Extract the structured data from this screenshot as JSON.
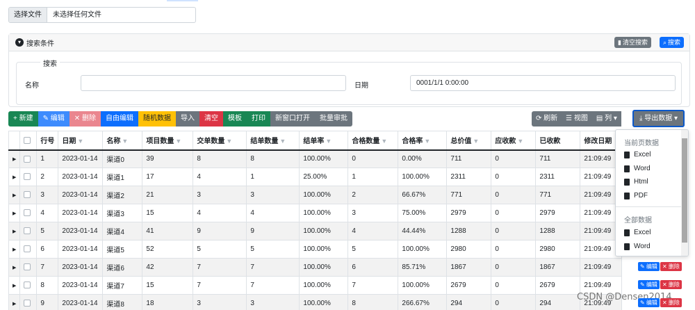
{
  "file_input": {
    "button": "选择文件",
    "text": "未选择任何文件"
  },
  "search_panel": {
    "title": "搜索条件",
    "clear_label": "清空搜索",
    "search_label": "搜索",
    "legend": "搜索",
    "name_label": "名称",
    "name_value": "",
    "date_label": "日期",
    "date_value": "0001/1/1 0:00:00"
  },
  "toolbar": {
    "new": "+ 新建",
    "edit": "✎ 编辑",
    "delete": "✕ 删除",
    "free_edit": "自由编辑",
    "random": "随机数据",
    "import": "导入",
    "clear": "清空",
    "template": "模板",
    "print": "打印",
    "new_window": "新窗口打开",
    "batch": "批量审批",
    "refresh": "⟳ 刷新",
    "view": "☰ 视图",
    "columns": "▤ 列 ▾",
    "export": "⤓ 导出数据 ▾"
  },
  "colors": {
    "green": "#198754",
    "blue": "#0d6efd",
    "red_light": "#ea868f",
    "yellow": "#ffc107",
    "red": "#dc3545",
    "gray": "#6c757d"
  },
  "table": {
    "headers": [
      "行号",
      "日期",
      "名称",
      "项目数量",
      "交单数量",
      "结单数量",
      "结单率",
      "合格数量",
      "合格率",
      "总价值",
      "应收款",
      "已收款",
      "修改日期"
    ],
    "rows": [
      [
        "1",
        "2023-01-14",
        "渠道0",
        "39",
        "8",
        "8",
        "100.00%",
        "0",
        "0.00%",
        "711",
        "0",
        "711",
        "21:09:49"
      ],
      [
        "2",
        "2023-01-14",
        "渠道1",
        "17",
        "4",
        "1",
        "25.00%",
        "1",
        "100.00%",
        "2311",
        "0",
        "2311",
        "21:09:49"
      ],
      [
        "3",
        "2023-01-14",
        "渠道2",
        "21",
        "3",
        "3",
        "100.00%",
        "2",
        "66.67%",
        "771",
        "0",
        "771",
        "21:09:49"
      ],
      [
        "4",
        "2023-01-14",
        "渠道3",
        "15",
        "4",
        "4",
        "100.00%",
        "3",
        "75.00%",
        "2979",
        "0",
        "2979",
        "21:09:49"
      ],
      [
        "5",
        "2023-01-14",
        "渠道4",
        "41",
        "9",
        "9",
        "100.00%",
        "4",
        "44.44%",
        "1288",
        "0",
        "1288",
        "21:09:49"
      ],
      [
        "6",
        "2023-01-14",
        "渠道5",
        "52",
        "5",
        "5",
        "100.00%",
        "5",
        "100.00%",
        "2980",
        "0",
        "2980",
        "21:09:49"
      ],
      [
        "7",
        "2023-01-14",
        "渠道6",
        "42",
        "7",
        "7",
        "100.00%",
        "6",
        "85.71%",
        "1867",
        "0",
        "1867",
        "21:09:49"
      ],
      [
        "8",
        "2023-01-14",
        "渠道7",
        "15",
        "7",
        "7",
        "100.00%",
        "7",
        "100.00%",
        "2679",
        "0",
        "2679",
        "21:09:49"
      ],
      [
        "9",
        "2023-01-14",
        "渠道8",
        "18",
        "3",
        "3",
        "100.00%",
        "8",
        "266.67%",
        "294",
        "0",
        "294",
        "21:09:49"
      ]
    ],
    "row_actions": {
      "edit": "✎ 编辑",
      "delete": "✕ 删除"
    }
  },
  "export_menu": {
    "current_header": "当前页数据",
    "current_items": [
      "Excel",
      "Word",
      "Html",
      "PDF"
    ],
    "all_header": "全部数据",
    "all_items": [
      "Excel",
      "Word"
    ]
  },
  "watermark": "CSDN @Densen2014"
}
